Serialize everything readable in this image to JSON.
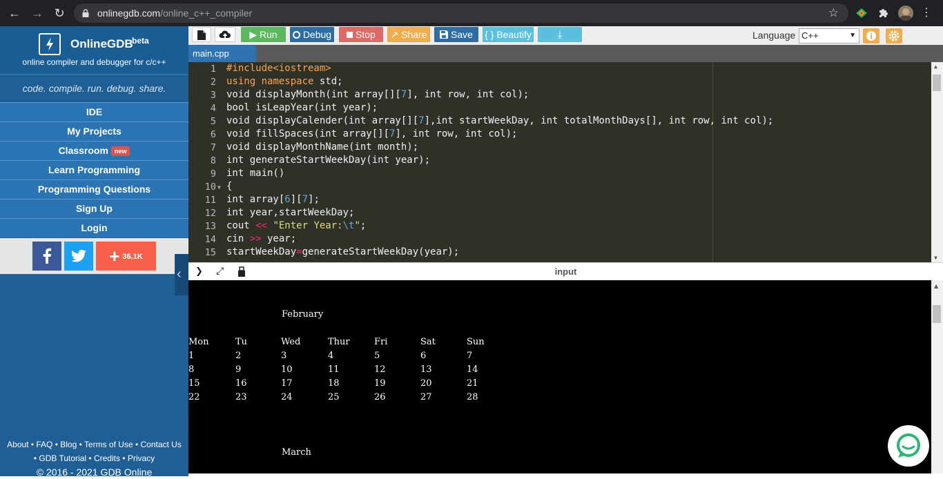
{
  "browser": {
    "url_host": "onlinegdb.com",
    "url_path": "/online_c++_compiler"
  },
  "sidebar": {
    "brand": "OnlineGDB",
    "beta": "beta",
    "tagline": "online compiler and debugger for c/c++",
    "slogan": "code. compile. run. debug. share.",
    "nav": [
      {
        "label": "IDE"
      },
      {
        "label": "My Projects"
      },
      {
        "label": "Classroom",
        "badge": "new"
      },
      {
        "label": "Learn Programming"
      },
      {
        "label": "Programming Questions"
      },
      {
        "label": "Sign Up"
      },
      {
        "label": "Login"
      }
    ],
    "social_count": "36.1K",
    "footer": {
      "line1": "About • FAQ • Blog • Terms of Use • Contact Us",
      "line2": "• GDB Tutorial • Credits • Privacy",
      "copyright": "© 2016 - 2021 GDB Online"
    }
  },
  "toolbar": {
    "run": "Run",
    "debug": "Debug",
    "stop": "Stop",
    "share": "Share",
    "save": "Save",
    "beautify": "{ } Beautify",
    "language_label": "Language",
    "language_value": "C++",
    "colors": {
      "run": "#5cb85c",
      "debug": "#2e6da4",
      "stop": "#d9534f",
      "share": "#f0ad4e",
      "save": "#2e6da4",
      "beautify": "#5bc0de",
      "download": "#5bc0de"
    }
  },
  "tab": {
    "filename": "main.cpp"
  },
  "editor": {
    "line_numbers": [
      "1",
      "2",
      "3",
      "4",
      "5",
      "6",
      "7",
      "8",
      "9",
      "10",
      "11",
      "12",
      "13",
      "14",
      "15"
    ],
    "lines": [
      "#include<iostream>",
      "using namespace std;",
      "void displayMonth(int array[][7], int row, int col);",
      "bool isLeapYear(int year);",
      "void displayCalender(int array[][7],int startWeekDay, int totalMonthDays[], int row, int col);",
      "void fillSpaces(int array[][7], int row, int col);",
      "void displayMonthName(int month);",
      "int generateStartWeekDay(int year);",
      "int main()",
      "{",
      "int array[6][7];",
      "int year,startWeekDay;",
      "cout << \"Enter Year:\\t\";",
      "cin >> year;",
      "startWeekDay=generateStartWeekDay(year);"
    ]
  },
  "console": {
    "title": "input",
    "month1": "February",
    "days": [
      "Mon",
      "Tu",
      "Wed",
      "Thur",
      "Fri",
      "Sat",
      "Sun"
    ],
    "rows": [
      [
        "1",
        "2",
        "3",
        "4",
        "5",
        "6",
        "7"
      ],
      [
        "8",
        "9",
        "10",
        "11",
        "12",
        "13",
        "14"
      ],
      [
        "15",
        "16",
        "17",
        "18",
        "19",
        "20",
        "21"
      ],
      [
        "22",
        "23",
        "24",
        "25",
        "26",
        "27",
        "28"
      ]
    ],
    "month2": "March"
  }
}
